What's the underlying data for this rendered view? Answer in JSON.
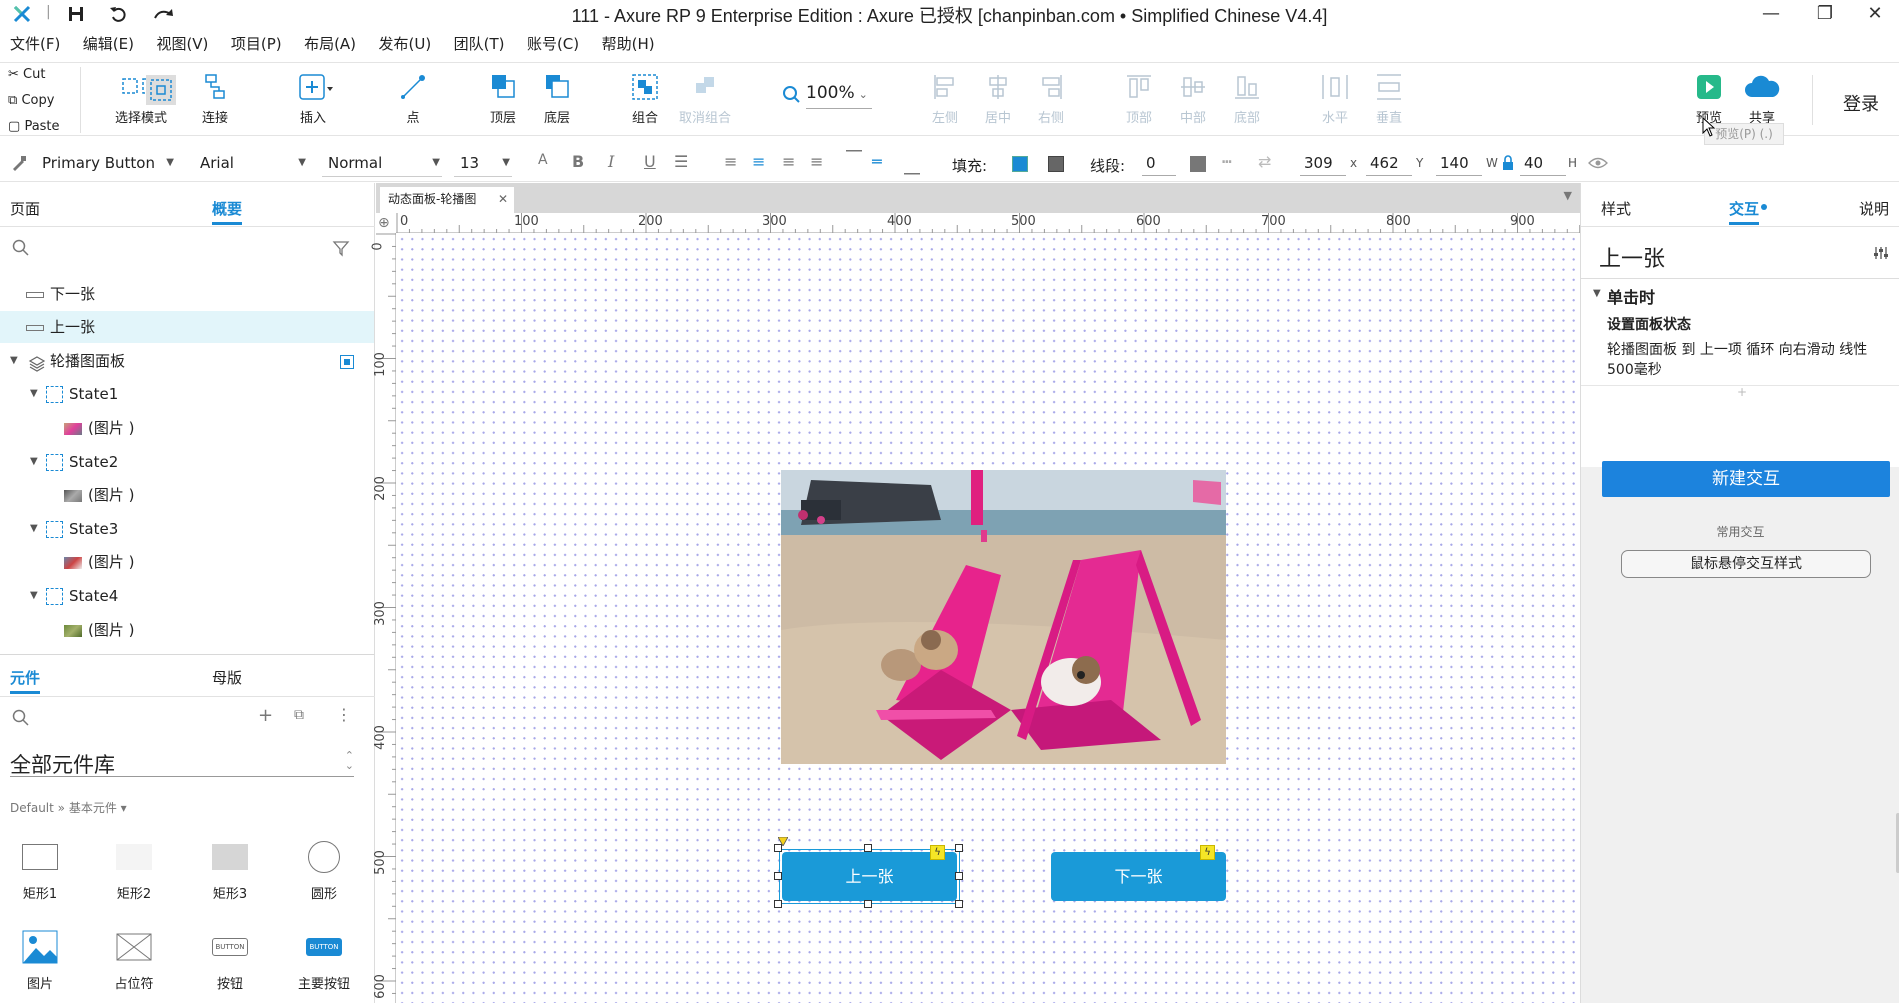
{
  "window": {
    "title": "111 - Axure RP 9 Enterprise Edition : Axure 已授权    [chanpinban.com • Simplified Chinese V4.4]",
    "minimize": "—",
    "maximize": "❐",
    "close": "✕"
  },
  "menu": [
    "文件(F)",
    "编辑(E)",
    "视图(V)",
    "项目(P)",
    "布局(A)",
    "发布(U)",
    "团队(T)",
    "账号(C)",
    "帮助(H)"
  ],
  "clipboard": {
    "cut": "Cut",
    "copy": "Copy",
    "paste": "Paste"
  },
  "toolbar": {
    "select_mode": "选择模式",
    "connect": "连接",
    "insert": "插入",
    "point": "点",
    "front": "顶层",
    "back": "底层",
    "group": "组合",
    "ungroup": "取消组合",
    "zoom": "100%",
    "align_left": "左侧",
    "align_center": "居中",
    "align_right": "右侧",
    "align_top": "顶部",
    "align_middle": "中部",
    "align_bottom": "底部",
    "dist_h": "水平",
    "dist_v": "垂直",
    "preview": "预览",
    "share": "共享",
    "login": "登录",
    "preview_tooltip": "预览(P) (.)"
  },
  "format": {
    "style": "Primary Button",
    "font": "Arial",
    "weight": "Normal",
    "size": "13",
    "fill_label": "填充:",
    "line_label": "线段:",
    "line_value": "0",
    "x": "309",
    "x_label": "x",
    "y": "462",
    "y_label": "Y",
    "w": "140",
    "w_label": "W",
    "h": "40",
    "h_label": "H",
    "fill_color": "#1a8ad4"
  },
  "left": {
    "tab_pages": "页面",
    "tab_outline": "概要",
    "tree": [
      {
        "label": "下一张"
      },
      {
        "label": "上一张"
      },
      {
        "label": "轮播图面板"
      },
      {
        "label": "State1"
      },
      {
        "label": "(图片 )"
      },
      {
        "label": "State2"
      },
      {
        "label": "(图片 )"
      },
      {
        "label": "State3"
      },
      {
        "label": "(图片 )"
      },
      {
        "label": "State4"
      },
      {
        "label": "(图片 )"
      }
    ],
    "tab_widgets": "元件",
    "tab_masters": "母版",
    "library": "全部元件库",
    "breadcrumb": "Default » 基本元件 ▾",
    "widgets": [
      {
        "label": "矩形1"
      },
      {
        "label": "矩形2"
      },
      {
        "label": "矩形3"
      },
      {
        "label": "圆形"
      },
      {
        "label": "图片"
      },
      {
        "label": "占位符"
      },
      {
        "label": "按钮"
      },
      {
        "label": "主要按钮"
      }
    ],
    "button_icon_text": "BUTTON"
  },
  "canvas": {
    "doc_tab": "动态面板-轮播图",
    "h_ticks": [
      "0",
      "100",
      "200",
      "300",
      "400",
      "500",
      "600",
      "700",
      "800",
      "900"
    ],
    "v_ticks": [
      "0",
      "100",
      "200",
      "300",
      "400",
      "500",
      "600"
    ],
    "prev_button": "上一张",
    "next_button": "下一张"
  },
  "right": {
    "tab_style": "样式",
    "tab_interact": "交互",
    "tab_notes": "说明",
    "widget_name": "上一张",
    "event": "单击时",
    "action": "设置面板状态",
    "action_detail": "轮播图面板 到 上一项 循环 向右滑动 线性 500毫秒",
    "new_interaction": "新建交互",
    "common": "常用交互",
    "hover_style": "鼠标悬停交互样式"
  }
}
